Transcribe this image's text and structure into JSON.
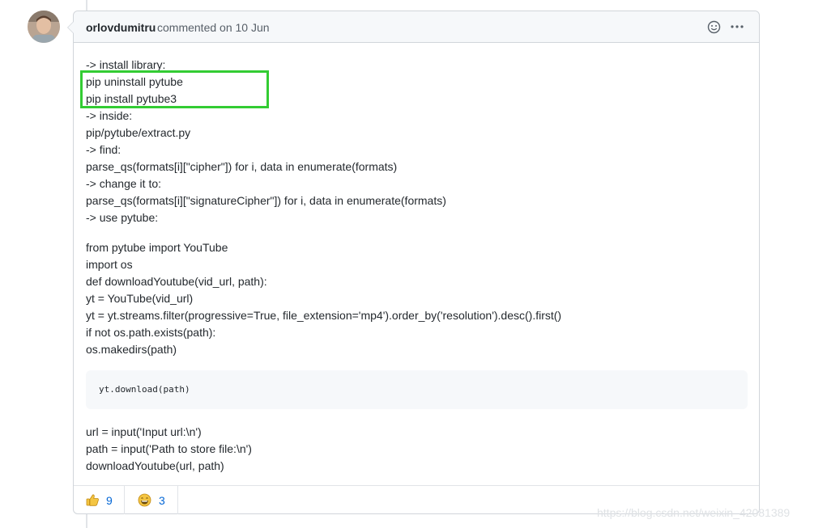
{
  "comment": {
    "author": "orlovdumitru",
    "meta": "commented on 10 Jun",
    "emoji_icon": "smiley-icon",
    "more_icon": "kebab-horizontal-icon"
  },
  "body_lines_a": [
    "-> install library:",
    "pip uninstall pytube",
    "pip install pytube3",
    "-> inside:",
    "pip/pytube/extract.py",
    "-> find:",
    "parse_qs(formats[i][\"cipher\"]) for i, data in enumerate(formats)",
    "-> change it to:",
    "parse_qs(formats[i][\"signatureCipher\"]) for i, data in enumerate(formats)",
    "-> use pytube:"
  ],
  "body_lines_b": [
    "from pytube import YouTube",
    "import os",
    "def downloadYoutube(vid_url, path):",
    "yt = YouTube(vid_url)",
    "yt = yt.streams.filter(progressive=True, file_extension='mp4').order_by('resolution').desc().first()",
    "if not os.path.exists(path):",
    "os.makedirs(path)"
  ],
  "code_block": "yt.download(path)",
  "body_lines_c": [
    "url = input('Input url:\\n')",
    "path = input('Path to store file:\\n')",
    "downloadYoutube(url, path)"
  ],
  "reactions": [
    {
      "icon": "thumbs-up-icon",
      "count": "9"
    },
    {
      "icon": "laugh-icon",
      "count": "3"
    }
  ],
  "highlight_color": "#33cc33",
  "watermark": "https://blog.csdn.net/weixin_42081389"
}
